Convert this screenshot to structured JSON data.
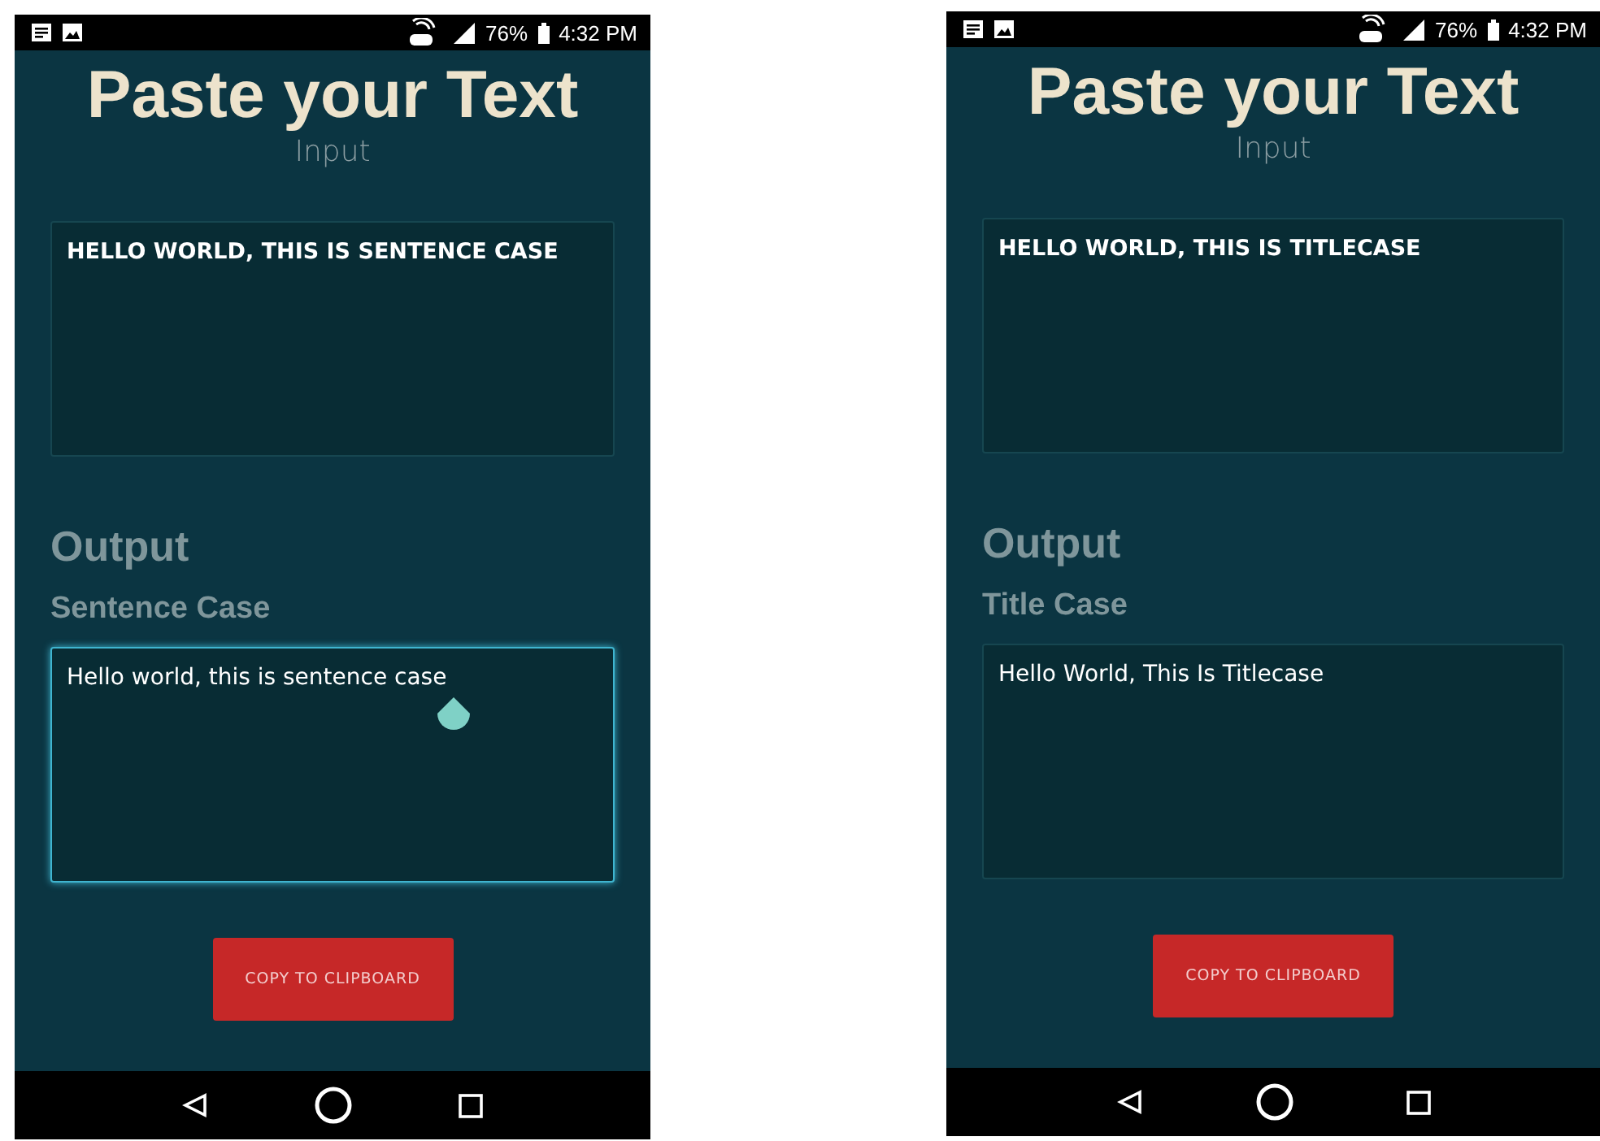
{
  "phones": [
    {
      "status_bar": {
        "battery": "76%",
        "time": "4:32 PM"
      },
      "title": "Paste your Text",
      "subtitle": "Input",
      "input": {
        "value": "HELLO WORLD, THIS IS SENTENCE CASE",
        "focused": false
      },
      "output_heading": "Output",
      "mode_label": "Sentence Case",
      "output": {
        "value": "Hello world, this is sentence case",
        "focused": true
      },
      "button": "COPY TO CLIPBOARD"
    },
    {
      "status_bar": {
        "battery": "76%",
        "time": "4:32 PM"
      },
      "title": "Paste your Text",
      "subtitle": "Input",
      "input": {
        "value": "HELLO WORLD, THIS IS TITLECASE",
        "focused": false
      },
      "output_heading": "Output",
      "mode_label": "Title Case",
      "output": {
        "value": "Hello World, This Is Titlecase",
        "focused": false
      },
      "button": "COPY TO CLIPBOARD"
    }
  ]
}
